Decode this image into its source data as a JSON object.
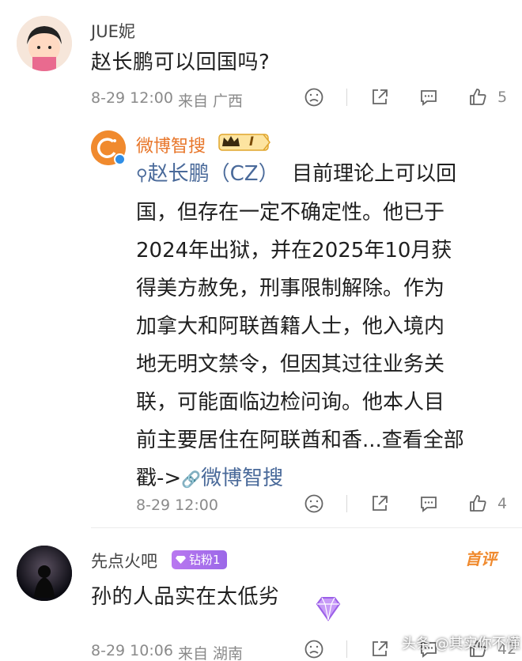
{
  "comments": [
    {
      "username": "JUE妮",
      "text": "赵长鹏可以回国吗?",
      "time": "8-29 12:00",
      "location": "来自 广西",
      "likes": "5"
    },
    {
      "username": "先点火吧",
      "fan_badge": "钻粉1",
      "first_tag": "首评",
      "text": "孙的人品实在太低劣",
      "time": "8-29 10:06",
      "location": "来自 湖南",
      "likes": "42"
    }
  ],
  "reply": {
    "username": "微博智搜",
    "level_badge": "I",
    "query": "赵长鹏（CZ）",
    "lines": [
      "目前理论上可以回",
      "国，但存在一定不确定性。他已于",
      "2024年出狱，并在2025年10月获",
      "得美方赦免，刑事限制解除。作为",
      "加拿大和阿联酋籍人士，他入境内",
      "地无明文禁令，但因其过往业务关",
      "联，可能面临边检问询。他本人目",
      "前主要居住在阿联酋和香...查看全部"
    ],
    "tail_prefix": "戳->",
    "tail_link": "微博智搜",
    "time": "8-29 12:00",
    "likes": "4"
  },
  "watermark": "头条 @其实你不懂",
  "colors": {
    "link": "#4a6a9a",
    "meta": "#8a8a8a",
    "first_tag": "#f08a2e",
    "fan_badge": "#a66fec",
    "weibo_orange": "#f08a2e"
  }
}
